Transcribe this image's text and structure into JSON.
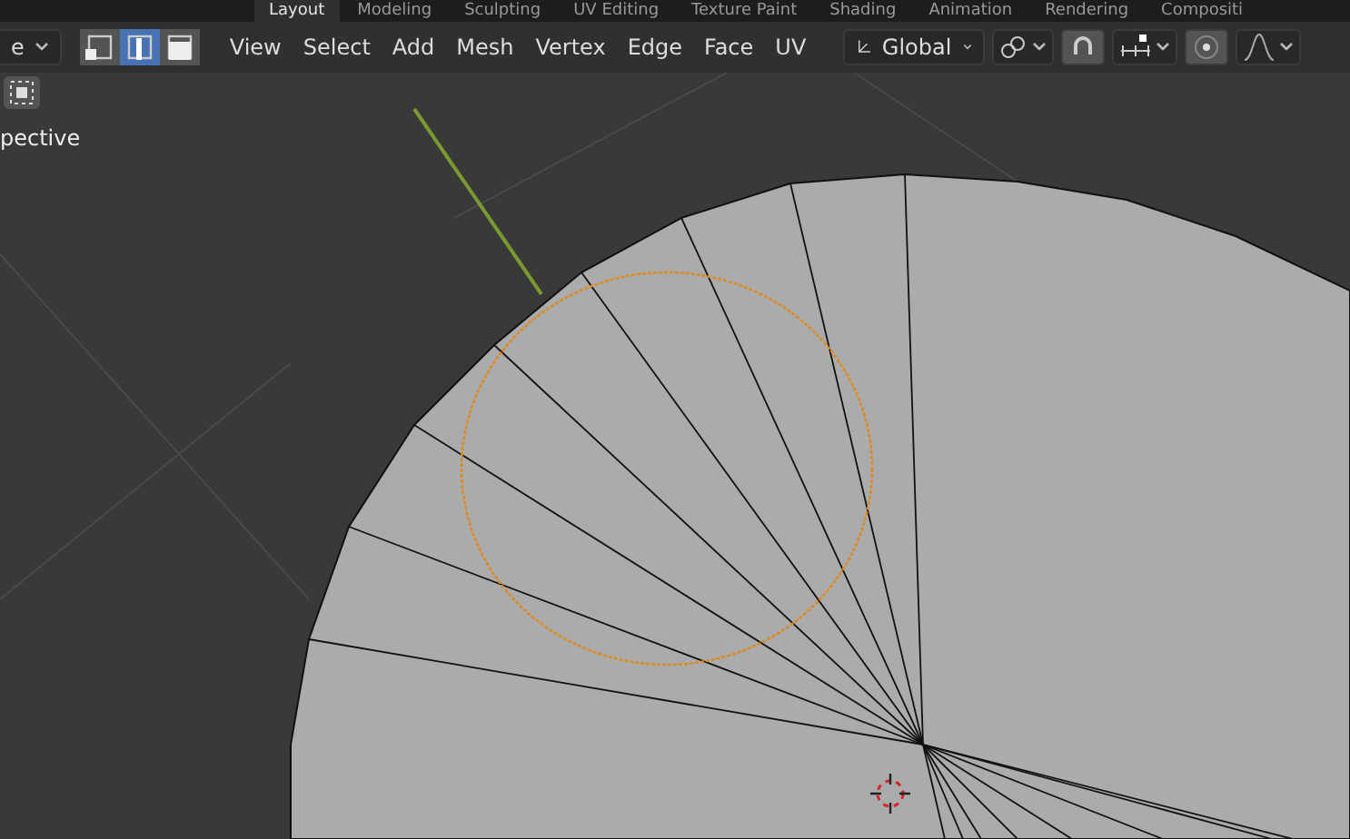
{
  "workspace_tabs": [
    {
      "label": "Layout",
      "selected": true
    },
    {
      "label": "Modeling",
      "selected": false
    },
    {
      "label": "Sculpting",
      "selected": false
    },
    {
      "label": "UV Editing",
      "selected": false
    },
    {
      "label": "Texture Paint",
      "selected": false
    },
    {
      "label": "Shading",
      "selected": false
    },
    {
      "label": "Animation",
      "selected": false
    },
    {
      "label": "Rendering",
      "selected": false
    },
    {
      "label": "Compositi",
      "selected": false
    }
  ],
  "mode_dropdown": {
    "value": "e"
  },
  "select_modes": [
    {
      "kind": "vertex",
      "selected": false
    },
    {
      "kind": "edge",
      "selected": true
    },
    {
      "kind": "face",
      "selected": false
    }
  ],
  "menus": [
    "View",
    "Select",
    "Add",
    "Mesh",
    "Vertex",
    "Edge",
    "Face",
    "UV"
  ],
  "orientation": {
    "value": "Global"
  },
  "viewport": {
    "label": "pective"
  }
}
